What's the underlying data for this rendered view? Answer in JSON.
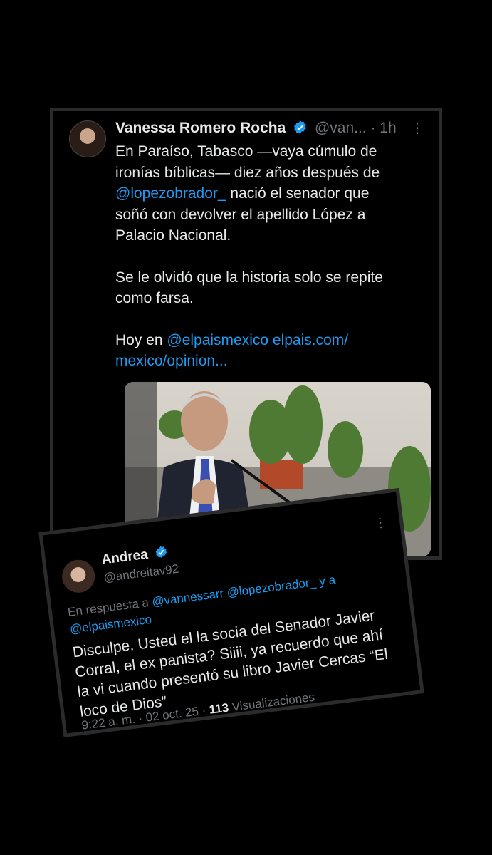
{
  "tweet": {
    "name": "Vanessa Romero Rocha",
    "handle": "@van...",
    "time": "· 1h",
    "more": "⋮",
    "paragraph1_text": "En Paraíso, Tabasco —vaya cúmulo de ironías bíblicas— diez años después de ",
    "mention1": "@lopezobrador_",
    "paragraph1_rest": " nació el senador que soñó con devolver el apellido López a Palacio Nacional.",
    "paragraph2": "Se le olvidó que la historia solo se repite como farsa.",
    "paragraph3_prefix": "Hoy en ",
    "mention2": "@elpaismexico",
    "link": " elpais.com/ mexico/opinion..."
  },
  "reply": {
    "name": "Andrea",
    "handle": "@andreitav92",
    "more": "⋮",
    "reply_prefix": "En respuesta a ",
    "reply_mentions": "@vannessarr @lopezobrador_ y a @elpaismexico",
    "text": "Disculpe. Usted el la socia del Senador Javier Corral, el ex panista? Siiii, ya recuerdo que ahí la vi cuando presentó su libro Javier Cercas “El loco de Dios”",
    "timestamp": "9:22 a. m. · 02 oct. 25 · ",
    "views_count": "113",
    "views_label": " Visualizaciones"
  },
  "colors": {
    "link": "#1d9bf0",
    "muted": "#71767b",
    "text": "#e7e9ea",
    "verified": "#1d9bf0"
  }
}
